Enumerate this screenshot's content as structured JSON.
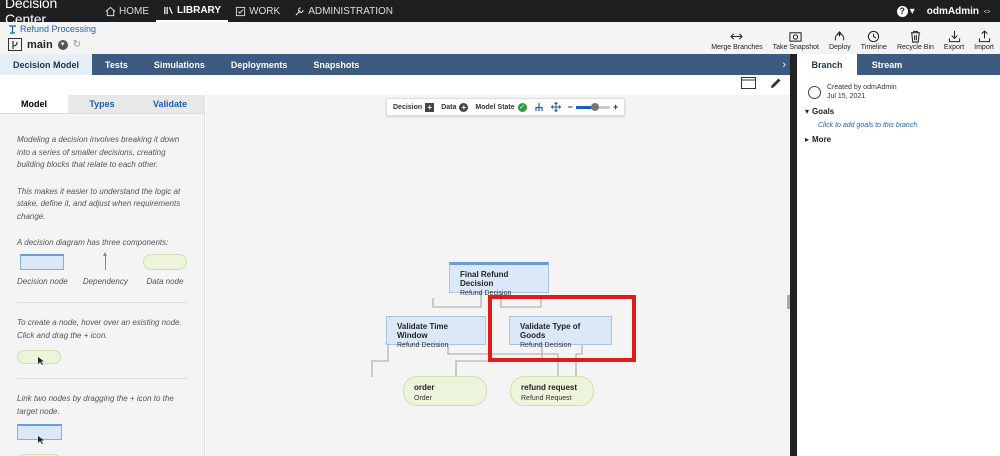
{
  "topbar": {
    "brand": "Decision Center",
    "nav": [
      {
        "label": "HOME",
        "icon": "home-icon",
        "active": false
      },
      {
        "label": "LIBRARY",
        "icon": "library-icon",
        "active": true
      },
      {
        "label": "WORK",
        "icon": "check-square-icon",
        "active": false
      },
      {
        "label": "ADMINISTRATION",
        "icon": "wrench-icon",
        "active": false
      }
    ],
    "help_icon": "?",
    "user": "odmAdmin"
  },
  "subheader": {
    "breadcrumb": "Refund Processing",
    "branch": "main"
  },
  "toolbar": {
    "merge": "Merge Branches",
    "snapshot": "Take Snapshot",
    "deploy": "Deploy",
    "timeline": "Timeline",
    "recycle": "Recycle Bin",
    "export": "Export",
    "import": "Import"
  },
  "tabs": [
    "Decision Model",
    "Tests",
    "Simulations",
    "Deployments",
    "Snapshots"
  ],
  "right_tabs": [
    "Branch",
    "Stream"
  ],
  "left_panel": {
    "tabs": [
      "Model",
      "Types",
      "Validate"
    ],
    "p1": "Modeling a decision involves breaking it down into a series of smaller decisions, creating building blocks that relate to each other.",
    "p2": "This makes it easier to understand the logic at stake, define it, and adjust when requirements change.",
    "p3": "A decision diagram has three components:",
    "legend_decision": "Decision node",
    "legend_dependency": "Dependency",
    "legend_data": "Data node",
    "p4": "To create a node, hover over an existing node. Click and drag the + icon.",
    "p5": "Link two nodes by dragging the + icon to the target node."
  },
  "canvas_toolbar": {
    "decision": "Decision",
    "data": "Data",
    "model_state": "Model State",
    "zoom_level": 0.55
  },
  "nodes": {
    "final": {
      "title": "Final Refund Decision",
      "sub": "Refund Decision"
    },
    "time": {
      "title": "Validate Time Window",
      "sub": "Refund Decision"
    },
    "goods": {
      "title": "Validate Type of Goods",
      "sub": "Refund Decision"
    },
    "order": {
      "title": "order",
      "sub": "Order"
    },
    "refund": {
      "title": "refund request",
      "sub": "Refund Request"
    }
  },
  "right_panel": {
    "created_by": "Created by odmAdmin",
    "date": "Jul 15, 2021",
    "goals": "Goals",
    "goals_link": "Click to add goals to this branch",
    "more": "More"
  },
  "colors": {
    "topbar": "#1d1f21",
    "tabsbar": "#3d5a80",
    "highlight": "#e01b1b",
    "decision_fill": "#dbe8f7",
    "data_fill": "#ecf4dc"
  }
}
